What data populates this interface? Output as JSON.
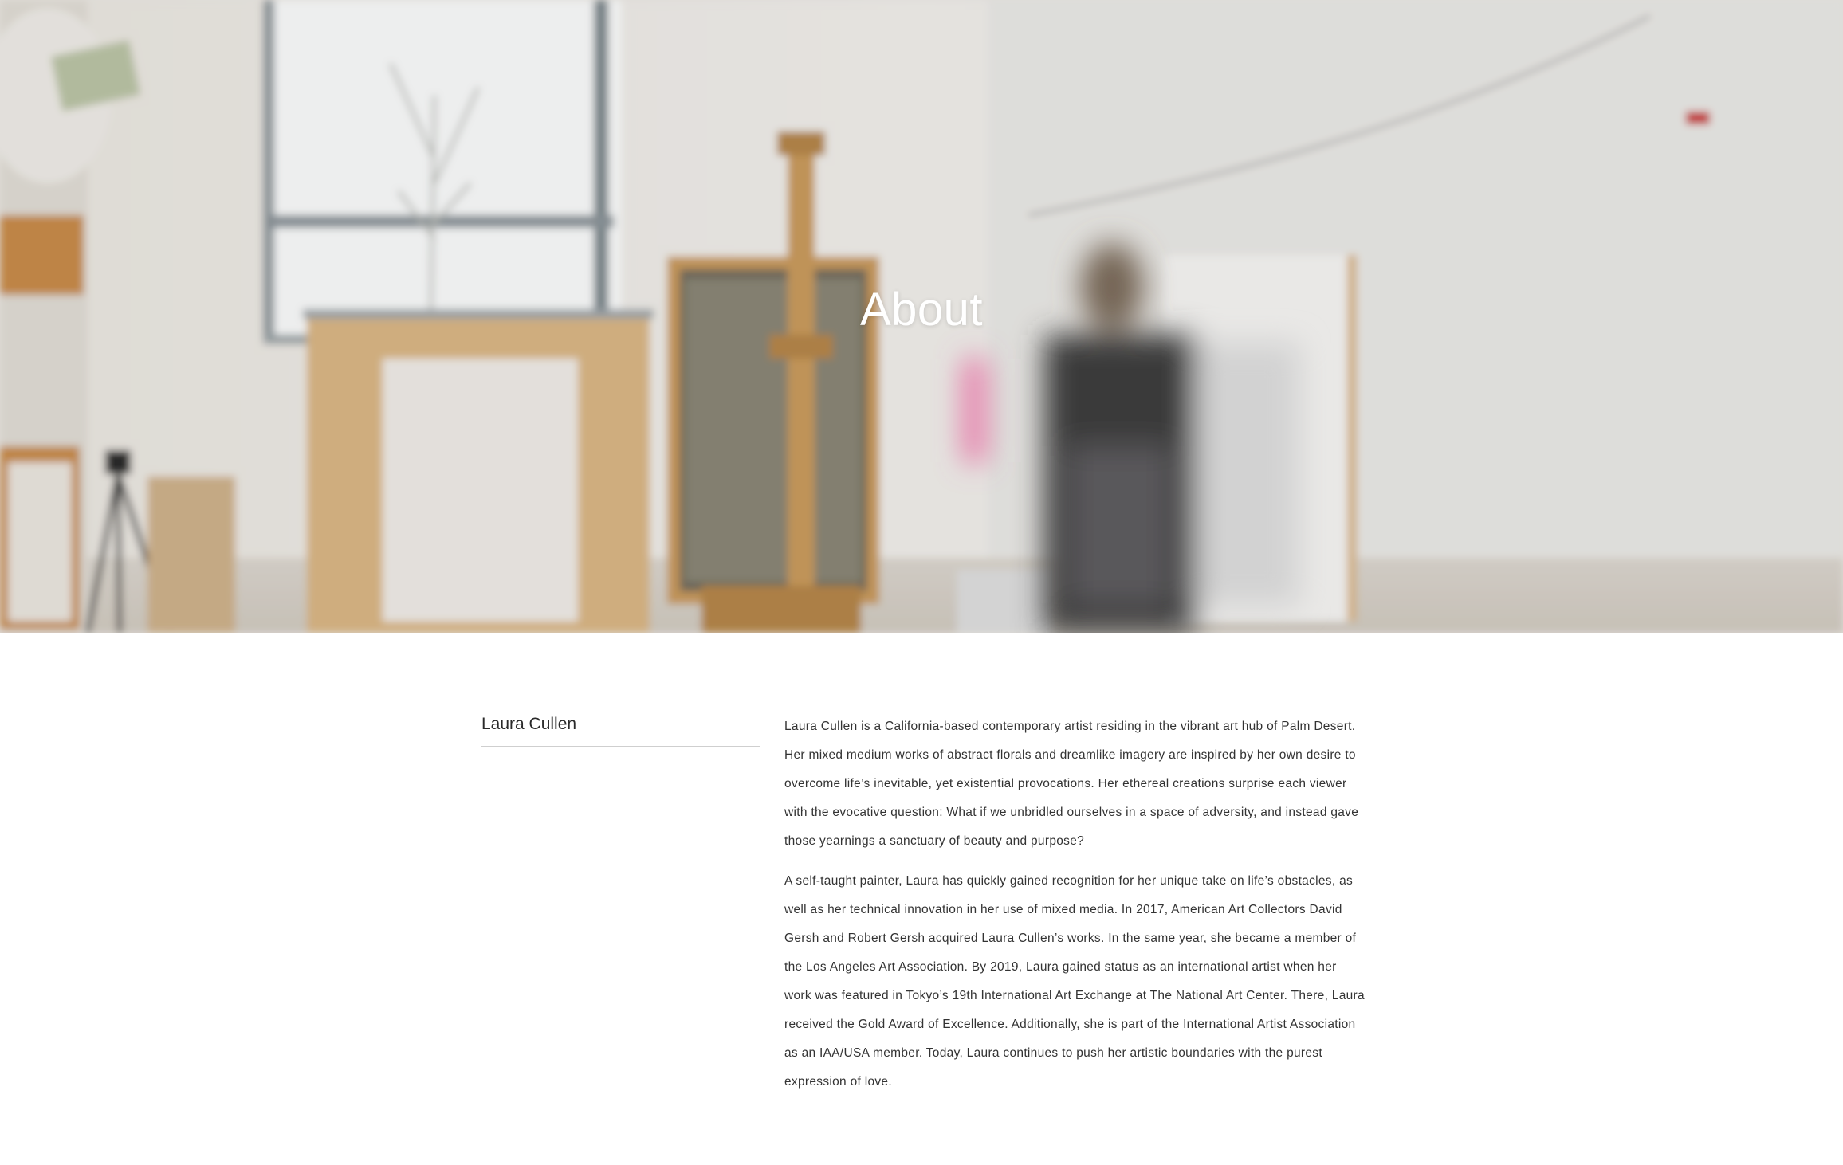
{
  "hero": {
    "title": "About",
    "image": "artist-studio-photo"
  },
  "artist": {
    "name": "Laura Cullen"
  },
  "bio": {
    "paragraphs": [
      "Laura Cullen is a California-based contemporary artist residing in the vibrant art hub of Palm Desert. Her mixed medium works of abstract florals and dreamlike imagery are inspired by her own desire to overcome life’s inevitable, yet existential provocations. Her ethereal creations surprise each viewer with the evocative question: What if we unbridled ourselves in a space of adversity, and instead gave those yearnings a sanctuary of beauty and purpose?",
      "A self-taught painter, Laura has quickly gained recognition for her unique take on life’s obstacles, as well as her technical innovation in her use of mixed media. In 2017, American Art Collectors David Gersh and Robert Gersh acquired Laura Cullen’s works. In the same year, she became a member of the Los Angeles Art Association. By 2019, Laura gained status as an international artist when her work was featured in Tokyo’s 19th International Art Exchange at The National Art Center. There, Laura received the Gold Award of Excellence. Additionally, she is part of the International Artist Association as an IAA/USA member. Today, Laura continues to push her artistic boundaries with the purest expression of love."
    ]
  },
  "colors": {
    "text": "#333333",
    "divider": "#cfcfcf",
    "hero_title": "#ffffff"
  }
}
